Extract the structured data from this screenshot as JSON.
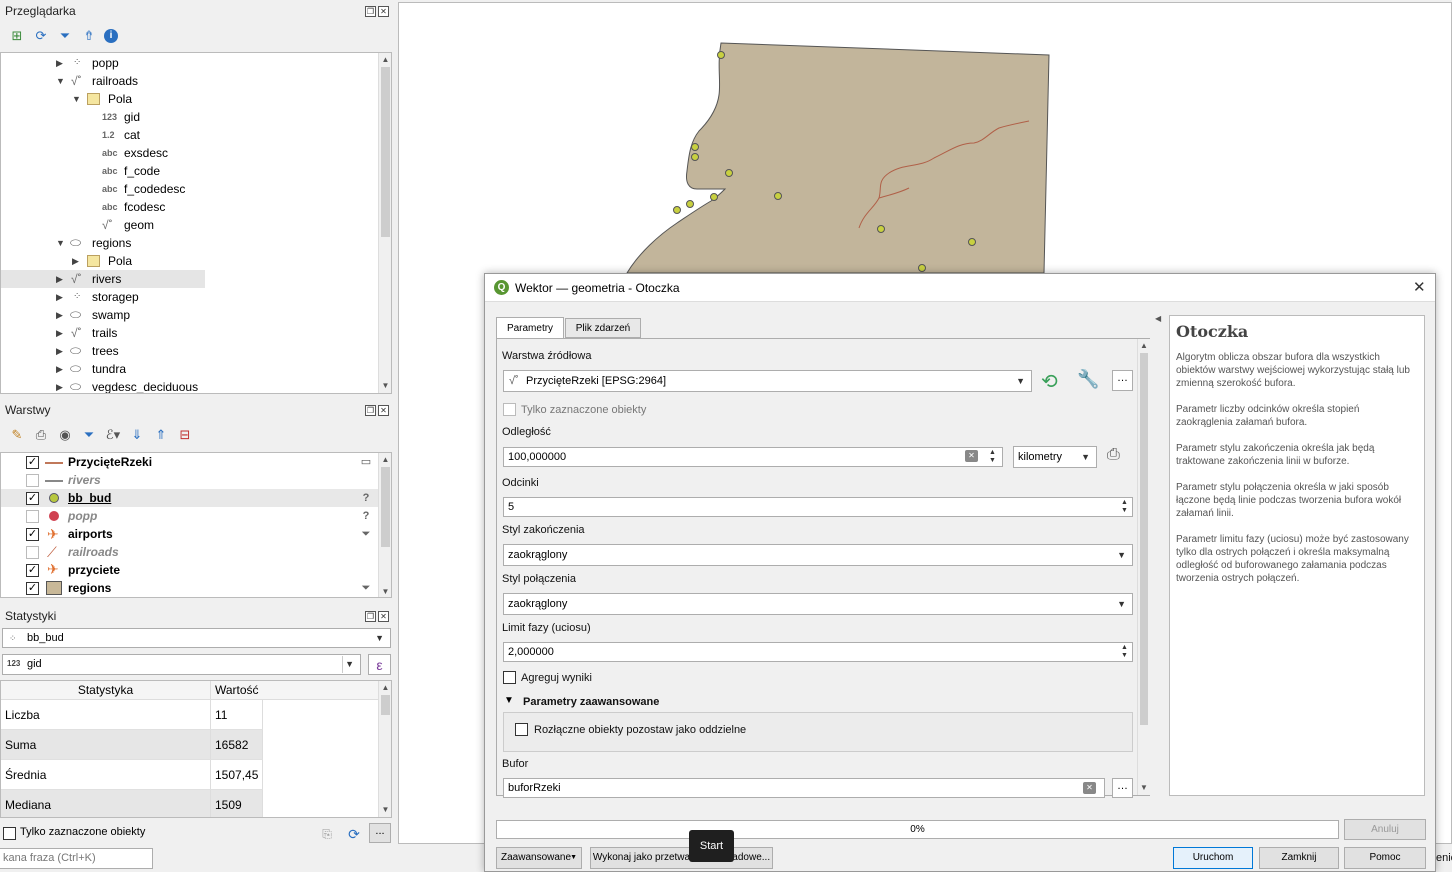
{
  "browser": {
    "title": "Przeglądarka",
    "items": [
      {
        "label": "popp",
        "icon": "point-layer-icon"
      },
      {
        "label": "railroads",
        "icon": "line-layer-icon"
      },
      {
        "label": "Pola",
        "icon": "fields-icon"
      },
      {
        "label": "gid",
        "icon": "123"
      },
      {
        "label": "cat",
        "icon": "1.2"
      },
      {
        "label": "exsdesc",
        "icon": "abc"
      },
      {
        "label": "f_code",
        "icon": "abc"
      },
      {
        "label": "f_codedesc",
        "icon": "abc"
      },
      {
        "label": "fcodesc",
        "icon": "abc"
      },
      {
        "label": "geom",
        "icon": "line-layer-icon"
      },
      {
        "label": "regions",
        "icon": "polygon-layer-icon"
      },
      {
        "label": "Pola",
        "icon": "fields-icon"
      },
      {
        "label": "rivers",
        "icon": "line-layer-icon"
      },
      {
        "label": "storagep",
        "icon": "point-layer-icon"
      },
      {
        "label": "swamp",
        "icon": "polygon-layer-icon"
      },
      {
        "label": "trails",
        "icon": "line-layer-icon"
      },
      {
        "label": "trees",
        "icon": "polygon-layer-icon"
      },
      {
        "label": "tundra",
        "icon": "polygon-layer-icon"
      },
      {
        "label": "vegdesc_deciduous",
        "icon": "polygon-layer-icon"
      }
    ],
    "icons": {
      "n123": "123",
      "n12": "1.2",
      "abc": "abc"
    }
  },
  "layers": {
    "title": "Warstwy",
    "items": [
      {
        "label": "PrzycięteRzeki",
        "checked": "✓",
        "color": "#c0785a"
      },
      {
        "label": "rivers",
        "checked": "",
        "color": "#888888"
      },
      {
        "label": "bb_bud",
        "checked": "✓",
        "color": "#b8c840"
      },
      {
        "label": "popp",
        "checked": "",
        "color": "#d04050"
      },
      {
        "label": "airports",
        "checked": "✓",
        "color": "#e07030"
      },
      {
        "label": "railroads",
        "checked": "",
        "color": "#c06040"
      },
      {
        "label": "przyciete",
        "checked": "✓",
        "color": "#e07030"
      },
      {
        "label": "regions",
        "checked": "✓",
        "color": "#c8b898"
      }
    ]
  },
  "stats": {
    "title": "Statystyki",
    "layer": "bb_bud",
    "field": "gid",
    "field_type": "123",
    "expr_icon": "ε",
    "col_stat": "Statystyka",
    "col_value": "Wartość",
    "rows": [
      {
        "name": "Liczba",
        "value": "11"
      },
      {
        "name": "Suma",
        "value": "16582"
      },
      {
        "name": "Średnia",
        "value": "1507,45"
      },
      {
        "name": "Mediana",
        "value": "1509"
      }
    ],
    "only_selected": "Tylko zaznaczone obiekty",
    "more": "..."
  },
  "search": {
    "placeholder": "kana fraza (Ctrl+K)"
  },
  "dialog": {
    "title": "Wektor — geometria - Otoczka",
    "tab_params": "Parametry",
    "tab_log": "Plik zdarzeń",
    "source_label": "Warstwa źródłowa",
    "source_value": "PrzycięteRzeki [EPSG:2964]",
    "only_selected": "Tylko zaznaczone obiekty",
    "distance_label": "Odległość",
    "distance_value": "100,000000",
    "distance_unit": "kilometry",
    "segments_label": "Odcinki",
    "segments_value": "5",
    "cap_label": "Styl zakończenia",
    "cap_value": "zaokrąglony",
    "join_label": "Styl połączenia",
    "join_value": "zaokrąglony",
    "miter_label": "Limit fazy (uciosu)",
    "miter_value": "2,000000",
    "dissolve_label": "Agreguj wyniki",
    "advanced_label": "Parametry zaawansowane",
    "separate_label": "Rozłączne obiekty pozostaw jako oddzielne",
    "buffer_label": "Bufor",
    "buffer_value": "buforRzeki",
    "progress": "0%",
    "cancel": "Anuluj",
    "advanced_btn": "Zaawansowane",
    "batch_btn": "Wykonaj jako przetwarzanie wsadowe...",
    "run": "Uruchom",
    "close": "Zamknij",
    "help": "Pomoc",
    "tooltip": "Start",
    "help_title": "Otoczka",
    "help_paragraphs": [
      "Algorytm oblicza obszar bufora dla wszystkich obiektów warstwy wejściowej wykorzystując stałą lub zmienną szerokość bufora.",
      "Parametr liczby odcinków określa stopień zaokrąglenia załamań bufora.",
      "Parametr stylu zakończenia określa jak będą traktowane zakończenia linii w buforze.",
      "Parametr stylu połączenia określa w jaki sposób łączone będą linie podczas tworzenia bufora wokół załamań linii.",
      "Parametr limitu fazy (uciosu) może być zastosowany tylko dla ostrych połączeń i określa maksymalną odległość od buforowanego załamania podczas tworzenia ostrych połączeń."
    ]
  },
  "map": {
    "polygon_color": "#c2b59b",
    "point_color": "#c8d040",
    "river_color": "#b06048"
  },
  "status_fragment": "enie"
}
